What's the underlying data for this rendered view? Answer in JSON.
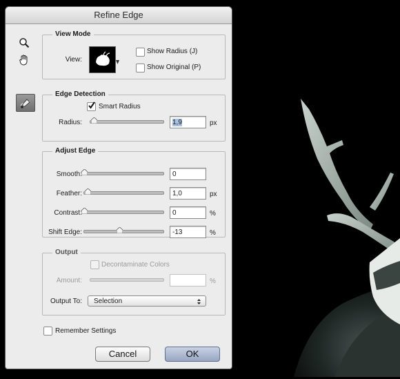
{
  "dialog": {
    "title": "Refine Edge"
  },
  "tools": {
    "zoom": "zoom-icon",
    "hand": "hand-icon",
    "refine_radius": "refine-radius-brush-icon"
  },
  "view_mode": {
    "title": "View Mode",
    "view_label": "View:",
    "show_radius_label": "Show Radius (J)",
    "show_original_label": "Show Original (P)",
    "show_radius_checked": false,
    "show_original_checked": false
  },
  "edge_detection": {
    "title": "Edge Detection",
    "smart_radius_label": "Smart Radius",
    "smart_radius_checked": true,
    "radius_label": "Radius:",
    "radius_value": "1,9",
    "radius_unit": "px",
    "radius_slider_fraction": 0.05
  },
  "adjust_edge": {
    "title": "Adjust Edge",
    "rows": [
      {
        "label": "Smooth:",
        "value": "0",
        "unit": "",
        "fraction": 0.0
      },
      {
        "label": "Feather:",
        "value": "1,0",
        "unit": "px",
        "fraction": 0.04
      },
      {
        "label": "Contrast:",
        "value": "0",
        "unit": "%",
        "fraction": 0.0
      },
      {
        "label": "Shift Edge:",
        "value": "-13",
        "unit": "%",
        "fraction": 0.44
      }
    ]
  },
  "output": {
    "title": "Output",
    "decontaminate_label": "Decontaminate Colors",
    "decontaminate_checked": false,
    "amount_label": "Amount:",
    "amount_value": "",
    "amount_unit": "%",
    "output_to_label": "Output To:",
    "output_to_value": "Selection"
  },
  "remember_settings_label": "Remember Settings",
  "remember_settings_checked": false,
  "buttons": {
    "cancel": "Cancel",
    "ok": "OK"
  },
  "colors": {
    "dialog_bg": "#ececec",
    "canvas_bg": "#000000",
    "ok_button": "#a8b5cf"
  }
}
